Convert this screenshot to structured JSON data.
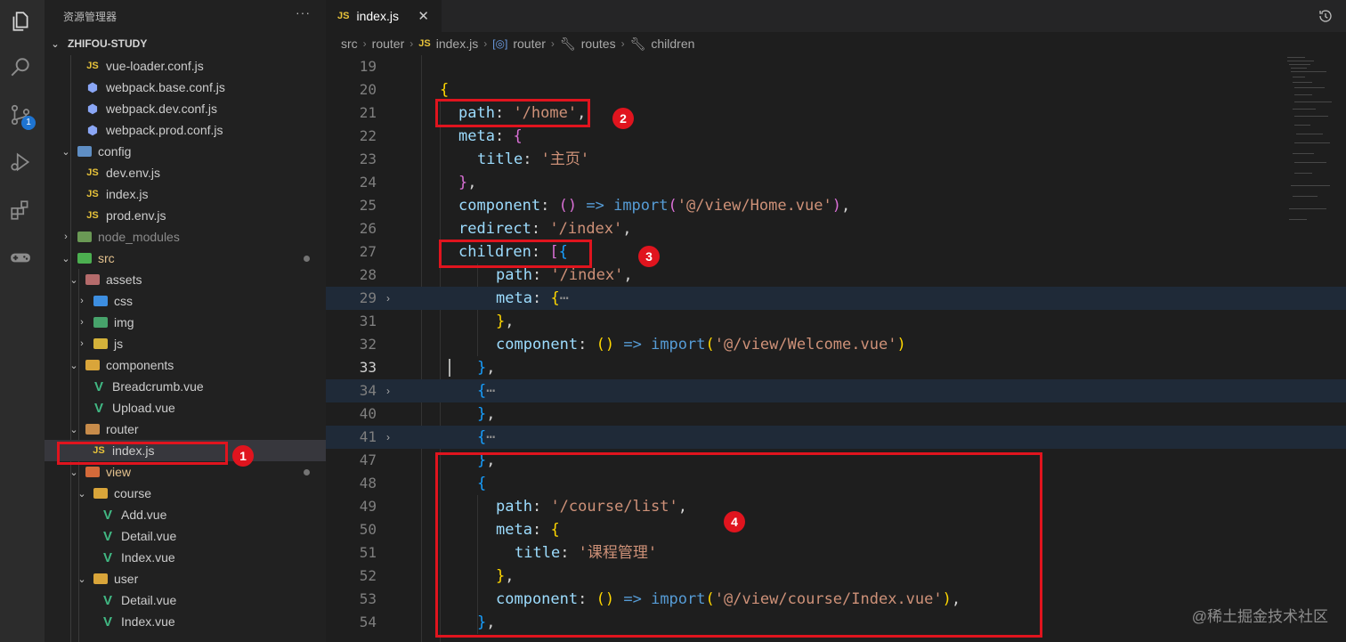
{
  "explorer": {
    "title": "资源管理器",
    "more": "···",
    "project": "ZHIFOU-STUDY",
    "items": [
      {
        "label": "vue-loader.conf.js",
        "icon": "js-file-icon",
        "kind": "js"
      },
      {
        "label": "webpack.base.conf.js",
        "icon": "webpack-file-icon",
        "kind": "hex"
      },
      {
        "label": "webpack.dev.conf.js",
        "icon": "webpack-file-icon",
        "kind": "hex"
      },
      {
        "label": "webpack.prod.conf.js",
        "icon": "webpack-file-icon",
        "kind": "hex"
      },
      {
        "label": "config",
        "icon": "config-folder-icon",
        "kind": "folder"
      },
      {
        "label": "dev.env.js",
        "icon": "js-file-icon",
        "kind": "js"
      },
      {
        "label": "index.js",
        "icon": "js-file-icon",
        "kind": "js"
      },
      {
        "label": "prod.env.js",
        "icon": "js-file-icon",
        "kind": "js"
      },
      {
        "label": "node_modules",
        "icon": "node-folder-icon",
        "kind": "folder"
      },
      {
        "label": "src",
        "icon": "src-folder-icon",
        "kind": "folder"
      },
      {
        "label": "assets",
        "icon": "assets-folder-icon",
        "kind": "folder"
      },
      {
        "label": "css",
        "icon": "css-folder-icon",
        "kind": "folder"
      },
      {
        "label": "img",
        "icon": "img-folder-icon",
        "kind": "folder"
      },
      {
        "label": "js",
        "icon": "js-folder-icon",
        "kind": "folder"
      },
      {
        "label": "components",
        "icon": "components-folder-icon",
        "kind": "folder"
      },
      {
        "label": "Breadcrumb.vue",
        "icon": "vue-file-icon",
        "kind": "vue"
      },
      {
        "label": "Upload.vue",
        "icon": "vue-file-icon",
        "kind": "vue"
      },
      {
        "label": "router",
        "icon": "router-folder-icon",
        "kind": "folder"
      },
      {
        "label": "index.js",
        "icon": "js-file-icon",
        "kind": "js"
      },
      {
        "label": "view",
        "icon": "view-folder-icon",
        "kind": "folder"
      },
      {
        "label": "course",
        "icon": "folder-icon",
        "kind": "folder"
      },
      {
        "label": "Add.vue",
        "icon": "vue-file-icon",
        "kind": "vue"
      },
      {
        "label": "Detail.vue",
        "icon": "vue-file-icon",
        "kind": "vue"
      },
      {
        "label": "Index.vue",
        "icon": "vue-file-icon",
        "kind": "vue"
      },
      {
        "label": "user",
        "icon": "folder-icon",
        "kind": "folder"
      },
      {
        "label": "Detail.vue",
        "icon": "vue-file-icon",
        "kind": "vue"
      },
      {
        "label": "Index.vue",
        "icon": "vue-file-icon",
        "kind": "vue"
      }
    ]
  },
  "tab": {
    "label": "index.js",
    "type": "JS",
    "close": "✕"
  },
  "breadcrumb": [
    "src",
    "router",
    "index.js",
    "router",
    "routes",
    "children"
  ],
  "breadcrumb_js": "JS",
  "badges": {
    "source_control": "1"
  },
  "lines": [
    {
      "n": "19"
    },
    {
      "n": "20"
    },
    {
      "n": "21"
    },
    {
      "n": "22"
    },
    {
      "n": "23"
    },
    {
      "n": "24"
    },
    {
      "n": "25"
    },
    {
      "n": "26"
    },
    {
      "n": "27"
    },
    {
      "n": "28"
    },
    {
      "n": "29"
    },
    {
      "n": "31"
    },
    {
      "n": "32"
    },
    {
      "n": "33"
    },
    {
      "n": "34"
    },
    {
      "n": "40"
    },
    {
      "n": "41"
    },
    {
      "n": "47"
    },
    {
      "n": "48"
    },
    {
      "n": "49"
    },
    {
      "n": "50"
    },
    {
      "n": "51"
    },
    {
      "n": "52"
    },
    {
      "n": "53"
    },
    {
      "n": "54"
    }
  ],
  "code": {
    "path_key": "path",
    "home_str": "'/home'",
    "meta_key": "meta",
    "title_key": "title",
    "home_title": "'主页'",
    "component_key": "component",
    "arrow": "=>",
    "import_kw": "import",
    "home_vue": "'@/view/Home.vue'",
    "redirect_key": "redirect",
    "index_str": "'/index'",
    "children_key": "children",
    "welcome_vue": "'@/view/Welcome.vue'",
    "ellipsis": "⋯",
    "course_list": "'/course/list'",
    "course_title": "'课程管理'",
    "course_index_vue": "'@/view/course/Index.vue'"
  },
  "annotations": [
    "1",
    "2",
    "3",
    "4"
  ],
  "watermark": "@稀土掘金技术社区",
  "colors": {
    "annotation": "#e0141e",
    "badge": "#1e74d1"
  }
}
